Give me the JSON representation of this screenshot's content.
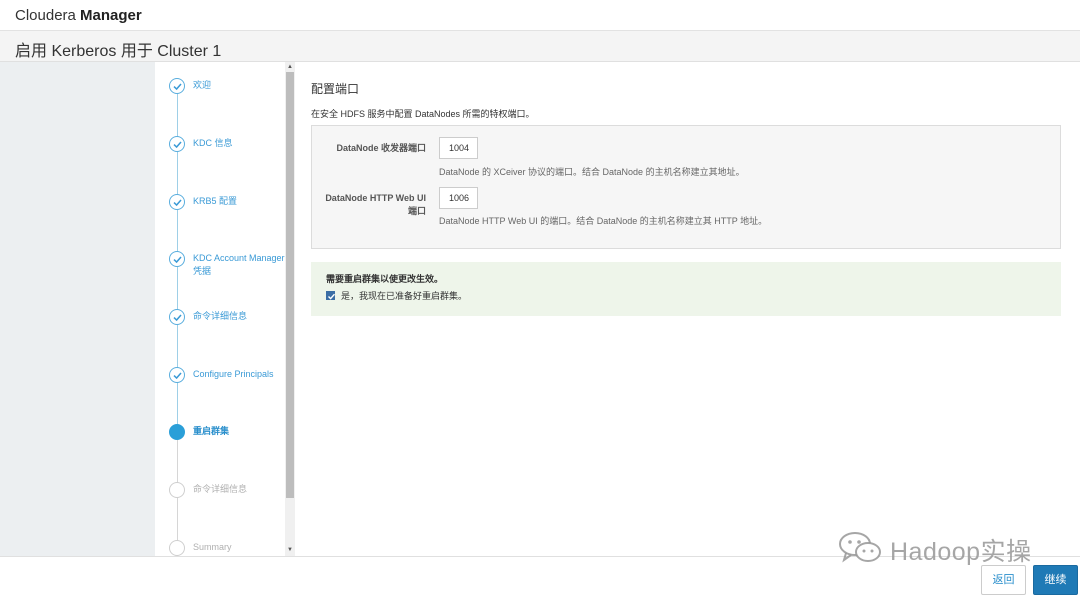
{
  "header": {
    "brand_light": "Cloudera",
    "brand_bold": "Manager"
  },
  "page_title": "启用 Kerberos 用于 Cluster 1",
  "wizard": {
    "steps": [
      {
        "label": "欢迎",
        "state": "done"
      },
      {
        "label": "KDC 信息",
        "state": "done"
      },
      {
        "label": "KRB5 配置",
        "state": "done"
      },
      {
        "label": "KDC Account Manager 凭据",
        "state": "done"
      },
      {
        "label": "命令详细信息",
        "state": "done"
      },
      {
        "label": "Configure Principals",
        "state": "done"
      },
      {
        "label": "重启群集",
        "state": "active"
      },
      {
        "label": "命令详细信息",
        "state": "pending"
      },
      {
        "label": "Summary",
        "state": "pending"
      }
    ]
  },
  "main": {
    "title": "配置端口",
    "description": "在安全 HDFS 服务中配置 DataNodes 所需的特权端口。",
    "fields": [
      {
        "label": "DataNode 收发器端口",
        "value": "1004",
        "help": "DataNode 的 XCeiver 协议的端口。结合 DataNode 的主机名称建立其地址。"
      },
      {
        "label_line1": "DataNode HTTP Web UI",
        "label_line2": "端口",
        "value": "1006",
        "help": "DataNode HTTP Web UI 的端口。结合 DataNode 的主机名称建立其 HTTP 地址。"
      }
    ],
    "notice": {
      "text": "需要重启群集以使更改生效。",
      "checkbox_label": "是，我现在已准备好重启群集。",
      "checked": true
    }
  },
  "footer": {
    "back_label": "返回",
    "continue_label": "继续"
  },
  "watermark": {
    "text": "Hadoop实操"
  },
  "colors": {
    "accent": "#2a9fd8",
    "primary_button": "#1f7ab6",
    "notice_bg": "#eef5ea"
  }
}
